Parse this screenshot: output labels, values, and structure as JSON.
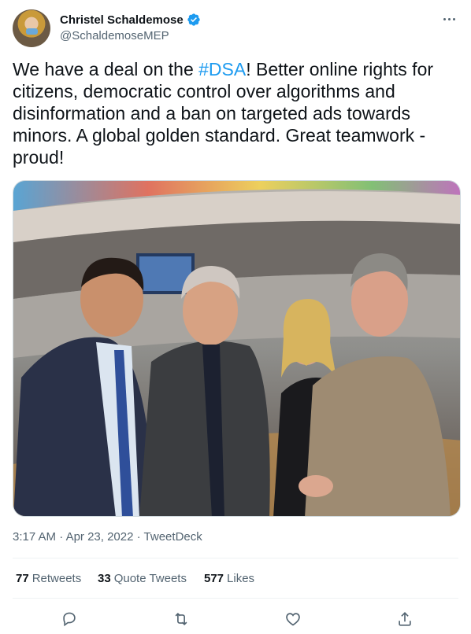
{
  "author": {
    "display_name": "Christel Schaldemose",
    "handle": "@SchaldemoseMEP",
    "verified": true
  },
  "tweet": {
    "text_before": "We have a deal on the ",
    "hashtag": "#DSA",
    "text_after": "! Better online rights for citizens, democratic control over algorithms and disinformation and a ban on targeted ads towards minors. A global golden standard. Great teamwork - proud!"
  },
  "meta": {
    "time": "3:17 AM",
    "separator": "·",
    "date": "Apr 23, 2022",
    "source": "TweetDeck"
  },
  "stats": [
    {
      "count": "77",
      "label": "Retweets"
    },
    {
      "count": "33",
      "label": "Quote Tweets"
    },
    {
      "count": "577",
      "label": "Likes"
    }
  ],
  "icons": {
    "more": "more-icon",
    "verified": "verified-badge-icon",
    "reply": "reply-icon",
    "retweet": "retweet-icon",
    "like": "heart-icon",
    "share": "share-icon"
  },
  "colors": {
    "accent": "#1d9bf0",
    "text": "#0f1419",
    "secondary": "#536471",
    "divider": "#eff3f4"
  }
}
